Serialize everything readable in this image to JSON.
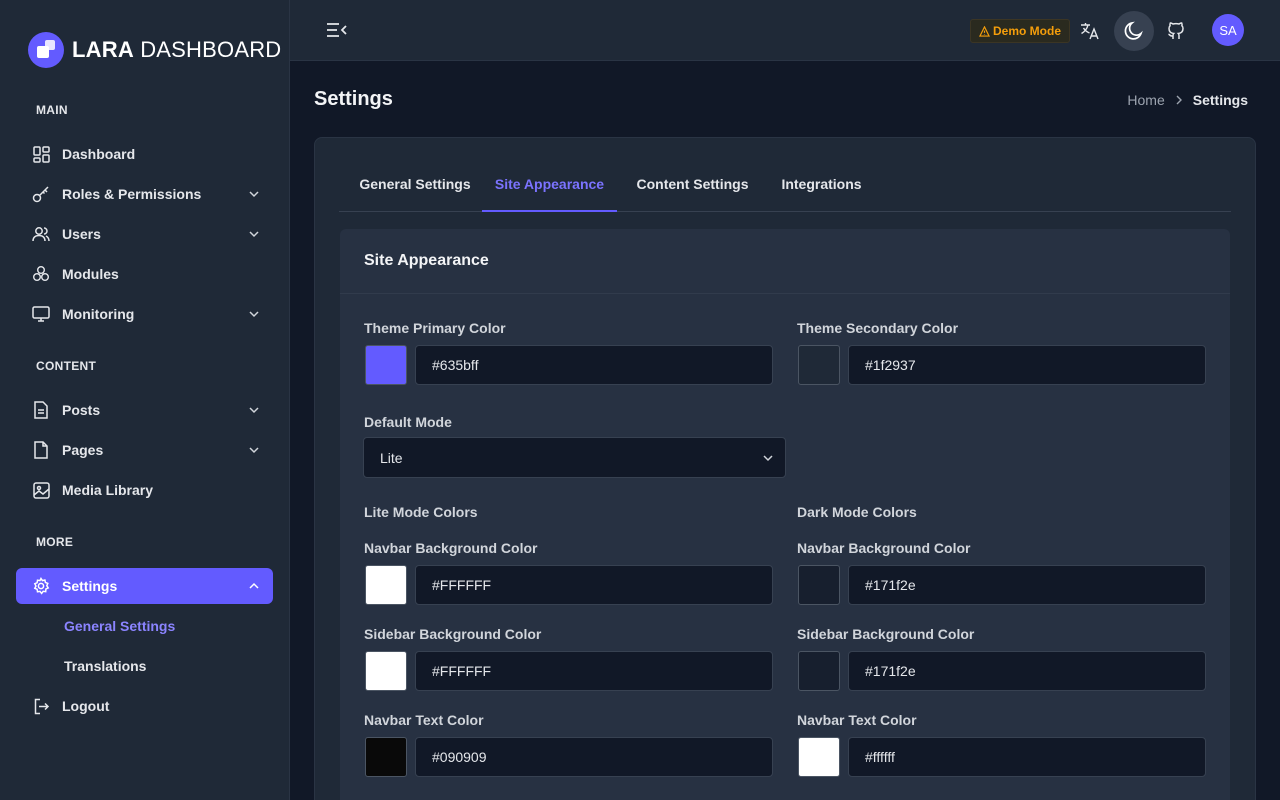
{
  "brand": {
    "bold": "LARA",
    "light": " DASHBOARD"
  },
  "sidebar": {
    "sections": [
      "MAIN",
      "CONTENT",
      "MORE"
    ],
    "items": [
      {
        "label": "Dashboard"
      },
      {
        "label": "Roles & Permissions"
      },
      {
        "label": "Users"
      },
      {
        "label": "Modules"
      },
      {
        "label": "Monitoring"
      },
      {
        "label": "Posts"
      },
      {
        "label": "Pages"
      },
      {
        "label": "Media Library"
      },
      {
        "label": "Settings"
      },
      {
        "label": "Logout"
      }
    ],
    "sub_items": [
      {
        "label": "General Settings"
      },
      {
        "label": "Translations"
      }
    ]
  },
  "header": {
    "demo_badge": "Demo Mode",
    "avatar": "SA"
  },
  "page": {
    "title": "Settings",
    "breadcrumb": {
      "home": "Home",
      "current": "Settings"
    }
  },
  "tabs": [
    {
      "label": "General Settings"
    },
    {
      "label": "Site Appearance"
    },
    {
      "label": "Content Settings"
    },
    {
      "label": "Integrations"
    }
  ],
  "panel": {
    "title": "Site Appearance",
    "primary": {
      "label": "Theme Primary Color",
      "value": "#635bff",
      "swatch": "#635bff"
    },
    "secondary": {
      "label": "Theme Secondary Color",
      "value": "#1f2937",
      "swatch": "#1f2937"
    },
    "default_mode": {
      "label": "Default Mode",
      "value": "Lite"
    },
    "lite_heading": "Lite Mode Colors",
    "dark_heading": "Dark Mode Colors",
    "lite": {
      "navbar_bg": {
        "label": "Navbar Background Color",
        "value": "#FFFFFF",
        "swatch": "#ffffff"
      },
      "sidebar_bg": {
        "label": "Sidebar Background Color",
        "value": "#FFFFFF",
        "swatch": "#ffffff"
      },
      "navbar_text": {
        "label": "Navbar Text Color",
        "value": "#090909",
        "swatch": "#090909"
      }
    },
    "dark": {
      "navbar_bg": {
        "label": "Navbar Background Color",
        "value": "#171f2e",
        "swatch": "#171f2e"
      },
      "sidebar_bg": {
        "label": "Sidebar Background Color",
        "value": "#171f2e",
        "swatch": "#171f2e"
      },
      "navbar_text": {
        "label": "Navbar Text Color",
        "value": "#ffffff",
        "swatch": "#ffffff"
      }
    }
  }
}
